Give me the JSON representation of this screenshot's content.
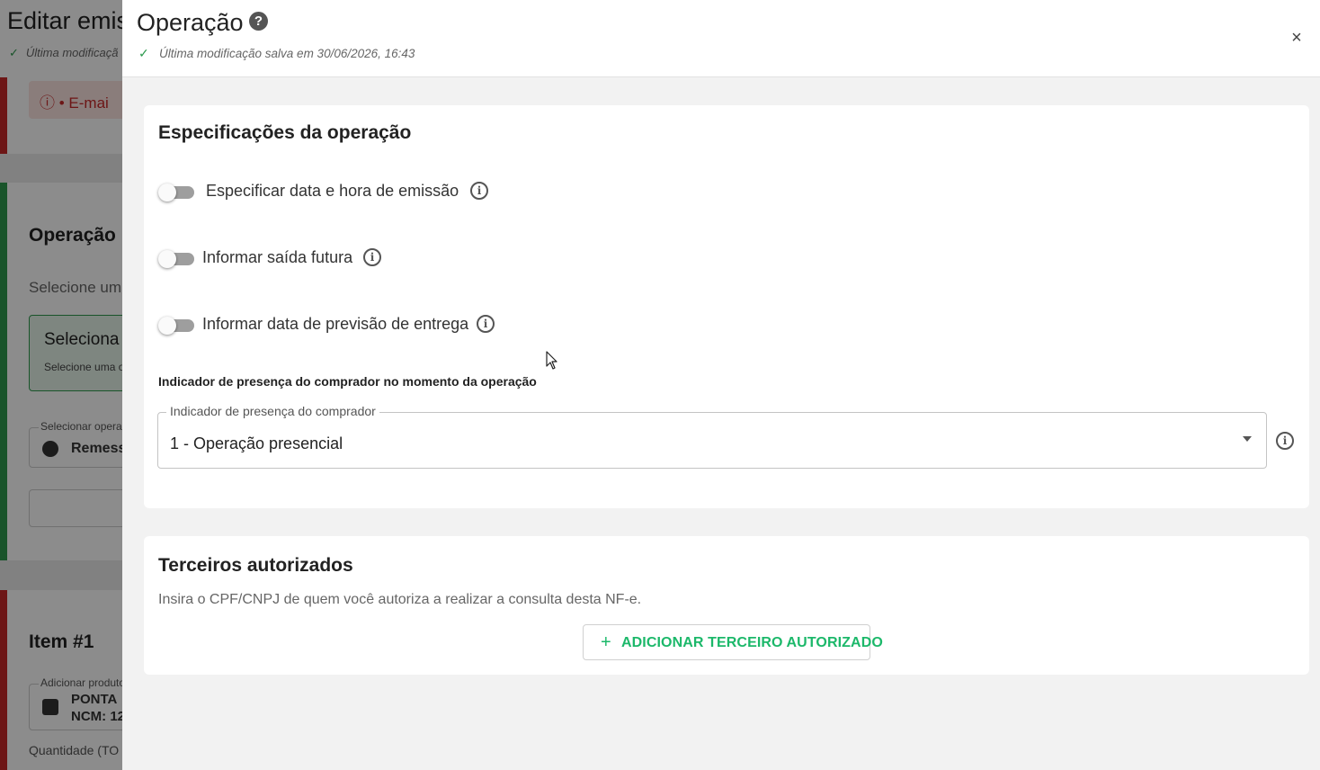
{
  "background": {
    "title": "Editar emis",
    "saved_text": "Última modificaçã",
    "alert_text": "E-mai",
    "operation_heading": "Operação",
    "operation_desc": "Selecione um",
    "select_box_title": "Seleciona",
    "select_box_desc": "Selecione uma o",
    "select_op_label": "Selecionar operaç",
    "select_op_value": "Remess",
    "item_heading": "Item #1",
    "add_product_label": "Adicionar produto",
    "product_line1": "PONTA",
    "product_line2": "NCM: 12",
    "quantity_label": "Quantidade (TO"
  },
  "drawer": {
    "title": "Operação",
    "help_glyph": "?",
    "saved_text": "Última modificação salva em 30/06/2026, 16:43",
    "close_glyph": "×",
    "spec_card": {
      "title": "Especificações da operação",
      "toggles": [
        {
          "label": "Especificar data e hora de emissão",
          "enabled": false
        },
        {
          "label": "Informar saída futura",
          "enabled": false
        },
        {
          "label": "Informar data de previsão de entrega",
          "enabled": false
        }
      ],
      "presence_section_label": "Indicador de presença do comprador no momento da operação",
      "presence_select": {
        "label": "Indicador de presença do comprador",
        "value": "1 - Operação presencial"
      }
    },
    "third_card": {
      "title": "Terceiros autorizados",
      "description": "Insira o CPF/CNPJ de quem você autoriza a realizar a consulta desta NF-e.",
      "add_button_label": "ADICIONAR TERCEIRO AUTORIZADO",
      "add_button_glyph": "+"
    }
  },
  "colors": {
    "accent_green": "#1cb86a",
    "check_green": "#2e9a4e",
    "error_red": "#c62828"
  },
  "icons": {
    "info_glyph": "i",
    "check_glyph": "✓"
  }
}
